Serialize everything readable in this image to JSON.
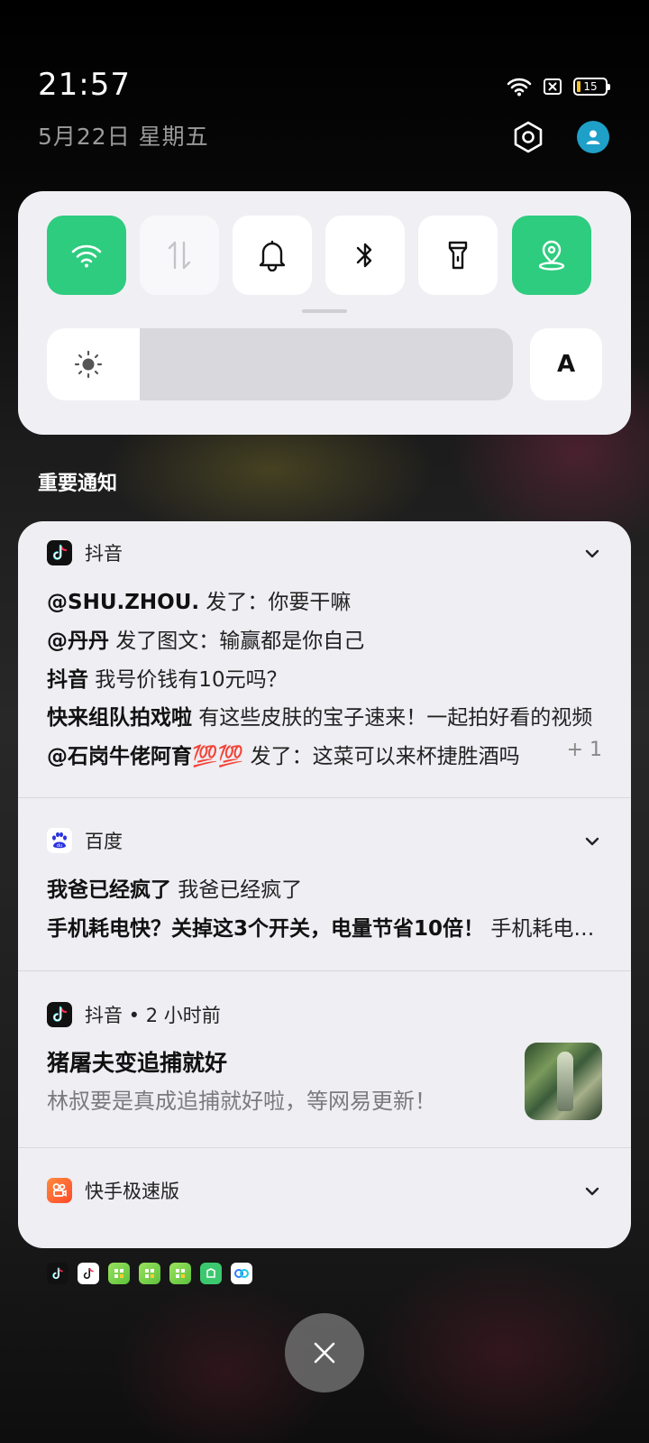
{
  "status_bar": {
    "time": "21:57",
    "date": "5月22日  星期五",
    "battery_level": "15"
  },
  "quick_settings": {
    "tiles": [
      {
        "name": "wifi",
        "on": true,
        "icon": "wifi-icon"
      },
      {
        "name": "mobile-data",
        "on": false,
        "icon": "data-arrows-icon"
      },
      {
        "name": "sound",
        "on": false,
        "icon": "bell-icon"
      },
      {
        "name": "bluetooth",
        "on": false,
        "icon": "bluetooth-icon"
      },
      {
        "name": "flashlight",
        "on": false,
        "icon": "flashlight-icon"
      },
      {
        "name": "location",
        "on": true,
        "icon": "location-icon"
      }
    ],
    "brightness_fraction": 0.2,
    "auto_label": "A"
  },
  "section_title": "重要通知",
  "notifications": {
    "douyin_group": {
      "app": "抖音",
      "lines": [
        {
          "bold": "@SHU.ZHOU.",
          "text": " 发了：你要干嘛"
        },
        {
          "bold": "@丹丹",
          "text": " 发了图文：输赢都是你自己"
        },
        {
          "bold": "抖音",
          "text": " 我号价钱有10元吗？"
        },
        {
          "bold": "快来组队拍戏啦",
          "text": " 有这些皮肤的宝子速来！一起拍好看的视频"
        },
        {
          "bold": "@石岗牛佬阿育💯💯",
          "text": " 发了：这菜可以来杯捷胜酒吗"
        }
      ],
      "extra_count": "+ 1"
    },
    "baidu_group": {
      "app": "百度",
      "lines": [
        {
          "bold": "我爸已经疯了",
          "text": " 我爸已经疯了"
        },
        {
          "bold": "手机耗电快？关掉这3个开关，电量节省10倍！",
          "text": " 手机耗电快？"
        }
      ]
    },
    "douyin_single": {
      "app": "抖音",
      "meta": "抖音 • 2 小时前",
      "title": "猪屠夫变追捕就好",
      "body": "林叔要是真成追捕就好啦，等网易更新！"
    },
    "kuaishou_group": {
      "app": "快手极速版"
    }
  },
  "colors": {
    "accent_green": "#2ecc7f",
    "panel_bg": "#f0f0f4",
    "user_avatar": "#1ea0c8"
  }
}
